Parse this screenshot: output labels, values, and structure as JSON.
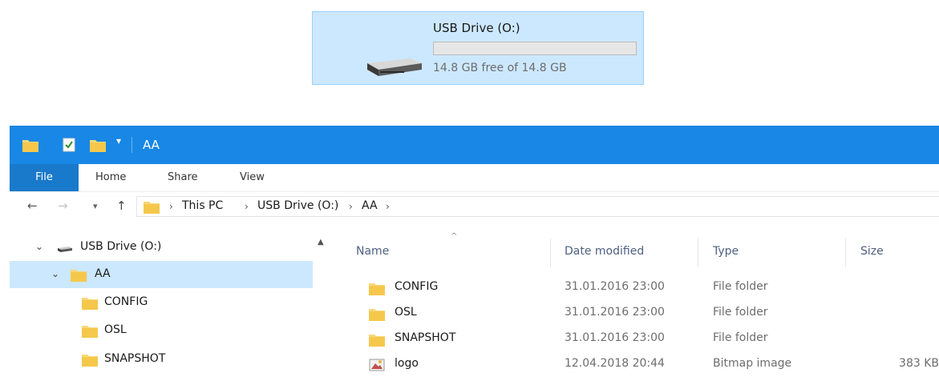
{
  "drive_tile": {
    "name": "USB Drive (O:)",
    "free_text": "14.8 GB free of 14.8 GB",
    "used_fraction": 0,
    "icon": "usb-drive-icon"
  },
  "window": {
    "title": "AA",
    "quick_access_icons": [
      "folder-icon",
      "properties-icon",
      "new-folder-icon",
      "dropdown-icon"
    ],
    "ribbon": {
      "file": "File",
      "tabs": [
        "Home",
        "Share",
        "View"
      ]
    },
    "address": {
      "back_icon": "back-arrow-icon",
      "forward_icon": "forward-arrow-icon",
      "recent_icon": "recent-dropdown-icon",
      "up_icon": "up-arrow-icon",
      "crumbs": [
        "This PC",
        "USB Drive (O:)",
        "AA"
      ]
    },
    "nav_pane": {
      "items": [
        {
          "label": "USB Drive (O:)",
          "icon": "drive-icon",
          "expanded": true
        },
        {
          "label": "AA",
          "icon": "folder-icon",
          "expanded": true,
          "selected": true
        },
        {
          "label": "CONFIG",
          "icon": "folder-icon"
        },
        {
          "label": "OSL",
          "icon": "folder-icon"
        },
        {
          "label": "SNAPSHOT",
          "icon": "folder-icon"
        }
      ]
    },
    "columns": {
      "name": "Name",
      "date": "Date modified",
      "type": "Type",
      "size": "Size"
    },
    "files": [
      {
        "name": "CONFIG",
        "date": "31.01.2016 23:00",
        "type": "File folder",
        "size": "",
        "icon": "folder-icon"
      },
      {
        "name": "OSL",
        "date": "31.01.2016 23:00",
        "type": "File folder",
        "size": "",
        "icon": "folder-icon"
      },
      {
        "name": "SNAPSHOT",
        "date": "31.01.2016 23:00",
        "type": "File folder",
        "size": "",
        "icon": "folder-icon"
      },
      {
        "name": "logo",
        "date": "12.04.2018 20:44",
        "type": "Bitmap image",
        "size": "383 KB",
        "icon": "bitmap-image-icon"
      }
    ]
  },
  "colors": {
    "title_bar": "#1887e5",
    "file_tab": "#1979ca",
    "selection": "#cce8ff",
    "folder": "#f5c84c"
  }
}
